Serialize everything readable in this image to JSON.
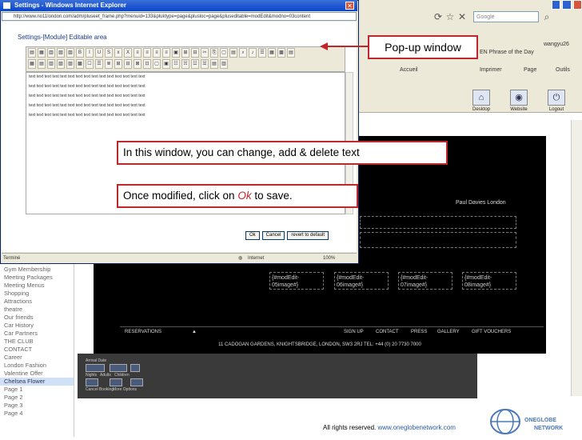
{
  "popup": {
    "title": "Settings - Windows Internet Explorer",
    "address": "http://www.no11london.com/adm/pluseet_frame.php?menuid=133&pluktype=page&plusloc=page&pluseditable=modEdit&modno=03content",
    "editable_area_title": "Settings-[Module] Editable area",
    "text_line": "text text text text text text text text text text text text text text text",
    "buttons": {
      "ok": "Ok",
      "cancel": "Cancel",
      "revert": "revert to default"
    },
    "status_left": "Terminé",
    "status_zone": "Internet",
    "status_zoom": "100%"
  },
  "background": {
    "search_placeholder": "Google",
    "phrase_of_day": "EN Phrase of the Day",
    "user": "wangyu26",
    "toolbar": {
      "accueil": "Accueil",
      "imprimer": "Imprimer",
      "page": "Page",
      "outils": "Outils"
    },
    "icons": [
      {
        "label": "Desktop",
        "icon": "desktop-icon"
      },
      {
        "label": "Website",
        "icon": "website-icon"
      },
      {
        "label": "Logout",
        "icon": "logout-icon"
      }
    ],
    "site_name": "Paul Davies London",
    "mod_edits": [
      "{#modEdit-\n05image#}",
      "{#modEdit-\n06image#}",
      "{#modEdit-\n07image#}",
      "{#modEdit-\n08image#}"
    ],
    "nav": [
      "RESERVATIONS",
      "SIGN UP",
      "CONTACT",
      "PRESS",
      "GALLERY",
      "GIFT VOUCHERS"
    ],
    "address_line": "11 CADOGAN GARDENS, KNIGHTSBRIDGE, LONDON, SW3 2RJ  TEL: +44 (0) 20 7730 7000",
    "panel_labels": {
      "arrival": "Arrival Date",
      "nights": "Nights",
      "adults": "Adults",
      "children": "Children",
      "cancel_booking": "Cancel Booking",
      "more_options": "More Options"
    },
    "sidebar": [
      "Gym Membership",
      "Meeting Packages",
      "Meeting Menus",
      "Shopping",
      "Attractions",
      "theatre",
      "Our friends",
      "Car History",
      "Car Partners",
      "THE CLUB",
      "CONTACT",
      "Career",
      "London Fashion",
      "Valentine Offer",
      "Chelsea Flower",
      "Page 1",
      "Page 2",
      "Page 3",
      "Page 4"
    ],
    "sidebar_active_index": 14,
    "footer_text": "All rights reserved.",
    "footer_link": "www.oneglobenetwork.com",
    "logo_line1": "ONEGLOBE",
    "logo_line2": "NETWORK"
  },
  "callouts": {
    "popup_window": "Pop-up window",
    "change_text": "In this window, you can change, add & delete text",
    "ok_prefix": "Once modified, click on ",
    "ok_word": "Ok",
    "ok_suffix": " to save."
  },
  "colors": {
    "callout_border": "#c0272d",
    "link": "#2a5aa8",
    "titlebar": "#0a46c8"
  }
}
